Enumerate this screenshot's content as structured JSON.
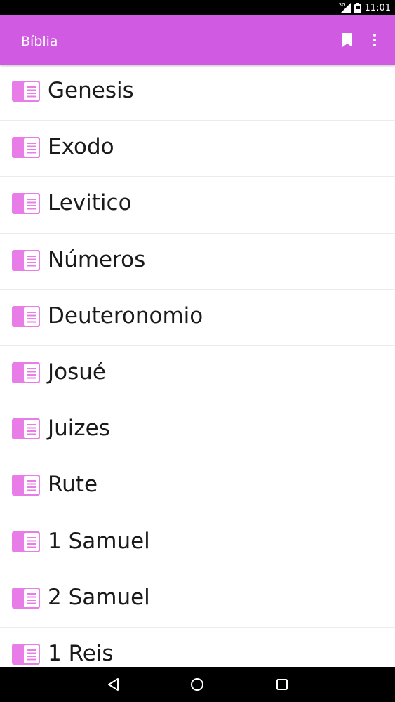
{
  "status_bar": {
    "network": "3G",
    "time": "11:01"
  },
  "app_bar": {
    "title": "Bíblia",
    "actions": [
      {
        "name": "bookmark",
        "icon": "bookmark-icon"
      },
      {
        "name": "more-options",
        "icon": "more-vert-icon"
      }
    ]
  },
  "books": [
    {
      "name": "Genesis"
    },
    {
      "name": "Exodo"
    },
    {
      "name": "Levitico"
    },
    {
      "name": "Números"
    },
    {
      "name": "Deuteronomio"
    },
    {
      "name": "Josué"
    },
    {
      "name": "Juizes"
    },
    {
      "name": "Rute"
    },
    {
      "name": "1 Samuel"
    },
    {
      "name": "2 Samuel"
    },
    {
      "name": "1 Reis"
    }
  ],
  "colors": {
    "accent": "#d05ae2",
    "book_icon": "#e87de8",
    "text": "#1a1a1a"
  },
  "nav_bar": {
    "buttons": [
      "back-icon",
      "home-icon",
      "recents-icon"
    ]
  }
}
